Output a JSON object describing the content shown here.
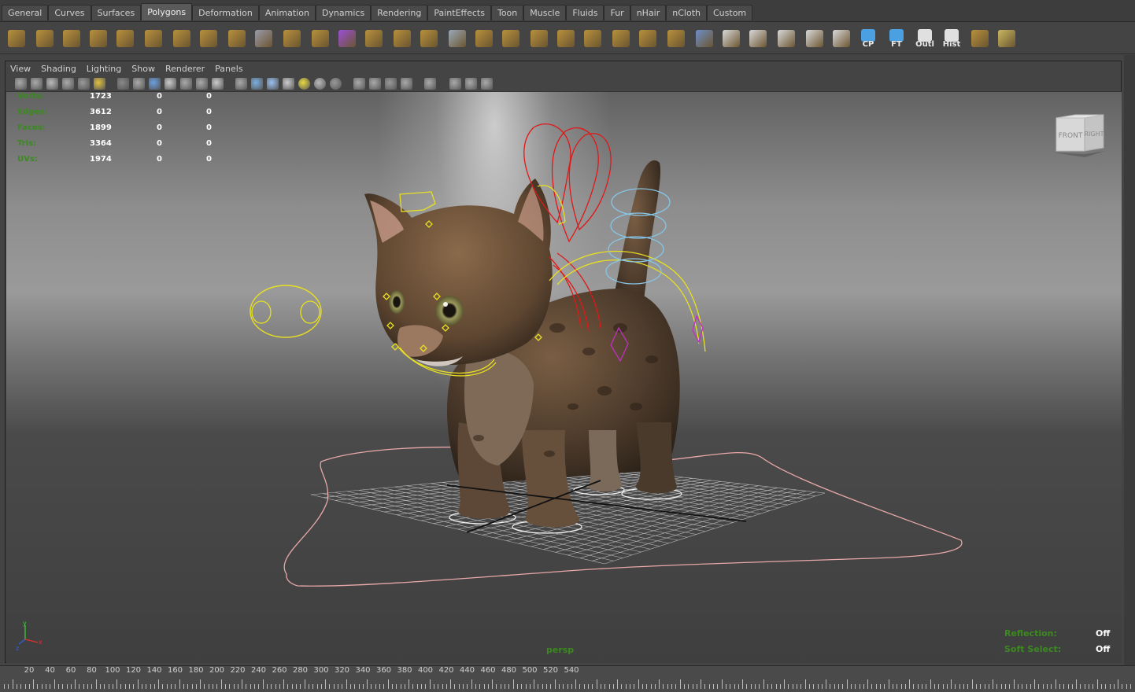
{
  "shelf_tabs": [
    "General",
    "Curves",
    "Surfaces",
    "Polygons",
    "Deformation",
    "Animation",
    "Dynamics",
    "Rendering",
    "PaintEffects",
    "Toon",
    "Muscle",
    "Fluids",
    "Fur",
    "nHair",
    "nCloth",
    "Custom"
  ],
  "active_tab": "Polygons",
  "shelf_icons": [
    {
      "name": "poly-sphere-icon",
      "color": "#b8913d",
      "caption": ""
    },
    {
      "name": "poly-cube-icon",
      "color": "#b8913d",
      "caption": ""
    },
    {
      "name": "poly-cylinder-icon",
      "color": "#b8913d",
      "caption": ""
    },
    {
      "name": "poly-cone-icon",
      "color": "#b8913d",
      "caption": ""
    },
    {
      "name": "poly-plane-icon",
      "color": "#b8913d",
      "caption": ""
    },
    {
      "name": "poly-torus-icon",
      "color": "#b8913d",
      "caption": ""
    },
    {
      "name": "poly-pyramid-icon",
      "color": "#b8913d",
      "caption": ""
    },
    {
      "name": "poly-pipe-icon",
      "color": "#b8913d",
      "caption": ""
    },
    {
      "name": "poly-soccer-icon",
      "color": "#b8913d",
      "caption": ""
    },
    {
      "name": "combine-icon",
      "color": "#9a9aaa",
      "caption": ""
    },
    {
      "name": "separate-icon",
      "color": "#b8913d",
      "caption": ""
    },
    {
      "name": "extract-icon",
      "color": "#b8913d",
      "caption": ""
    },
    {
      "name": "smooth-cube-icon",
      "color": "#9b4fd6",
      "caption": ""
    },
    {
      "name": "extrude-face-icon",
      "color": "#b8913d",
      "caption": ""
    },
    {
      "name": "bridge-icon",
      "color": "#b8913d",
      "caption": ""
    },
    {
      "name": "append-polygon-icon",
      "color": "#b8913d",
      "caption": ""
    },
    {
      "name": "split-polygon-icon",
      "color": "#9aa9b8",
      "caption": ""
    },
    {
      "name": "insert-edge-loop-icon",
      "color": "#b8913d",
      "caption": ""
    },
    {
      "name": "offset-edge-icon",
      "color": "#b8913d",
      "caption": ""
    },
    {
      "name": "bevel-icon",
      "color": "#b8913d",
      "caption": ""
    },
    {
      "name": "merge-icon",
      "color": "#b8913d",
      "caption": ""
    },
    {
      "name": "collapse-icon",
      "color": "#b8913d",
      "caption": ""
    },
    {
      "name": "delete-edge-icon",
      "color": "#b8913d",
      "caption": ""
    },
    {
      "name": "chamfer-icon",
      "color": "#b8913d",
      "caption": ""
    },
    {
      "name": "poke-icon",
      "color": "#b8913d",
      "caption": ""
    },
    {
      "name": "planar-map-icon",
      "color": "#6e8fc8",
      "caption": ""
    },
    {
      "name": "cylindrical-map-icon",
      "color": "#d9d9d9",
      "caption": ""
    },
    {
      "name": "spherical-map-icon",
      "color": "#d9d9d9",
      "caption": ""
    },
    {
      "name": "auto-map-icon",
      "color": "#d9d9d9",
      "caption": ""
    },
    {
      "name": "checker-icon",
      "color": "#d9d9d9",
      "caption": ""
    },
    {
      "name": "uv-editor-icon",
      "color": "#d9d9d9",
      "caption": ""
    },
    {
      "name": "cp-icon",
      "color": "#4aa0e0",
      "caption": "CP"
    },
    {
      "name": "ft-icon",
      "color": "#4aa0e0",
      "caption": "FT"
    },
    {
      "name": "outliner-icon",
      "color": "#e0e0e0",
      "caption": "Outl"
    },
    {
      "name": "history-icon",
      "color": "#e0e0e0",
      "caption": "Hist"
    },
    {
      "name": "extra-tool-1-icon",
      "color": "#b8913d",
      "caption": ""
    },
    {
      "name": "extra-tool-2-icon",
      "color": "#b8913d",
      "caption": ""
    },
    {
      "name": "extra-tool-3-icon",
      "color": "#c8b860",
      "caption": ""
    }
  ],
  "panel_menu": [
    "View",
    "Shading",
    "Lighting",
    "Show",
    "Renderer",
    "Panels"
  ],
  "poly_count": [
    {
      "label": "Verts:",
      "v1": "1723",
      "v2": "0",
      "v3": "0"
    },
    {
      "label": "Edges:",
      "v1": "3612",
      "v2": "0",
      "v3": "0"
    },
    {
      "label": "Faces:",
      "v1": "1899",
      "v2": "0",
      "v3": "0"
    },
    {
      "label": "Tris:",
      "v1": "3364",
      "v2": "0",
      "v3": "0"
    },
    {
      "label": "UVs:",
      "v1": "1974",
      "v2": "0",
      "v3": "0"
    }
  ],
  "viewcube": {
    "front": "FRONT",
    "right": "RIGHT"
  },
  "camera_name": "persp",
  "status": {
    "reflection_label": "Reflection:",
    "reflection_value": "Off",
    "soft_select_label": "Soft Select:",
    "soft_select_value": "Off"
  },
  "axis": {
    "x": "x",
    "y": "y",
    "z": "z"
  },
  "timeline_ticks": [
    "20",
    "40",
    "60",
    "80",
    "100",
    "120",
    "140",
    "160",
    "180",
    "200",
    "220",
    "240",
    "260",
    "280",
    "300",
    "320",
    "340",
    "360",
    "380",
    "400",
    "420",
    "440",
    "460",
    "480",
    "500",
    "520",
    "540"
  ]
}
